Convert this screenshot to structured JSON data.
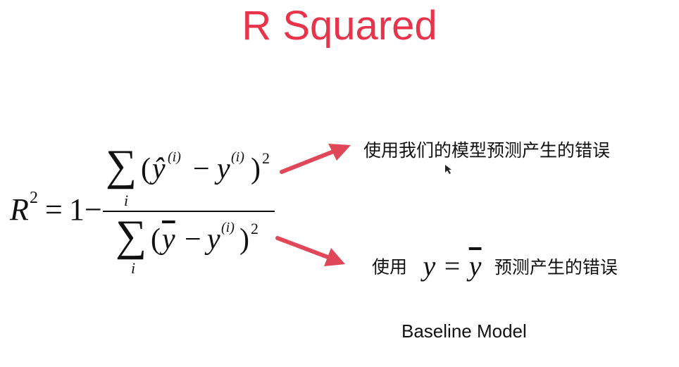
{
  "title": "R Squared",
  "formula": {
    "lhs": "R",
    "lhs_sup": "2",
    "equals": "=",
    "one_minus": "1−",
    "sum": "∑",
    "index": "i",
    "numerator": {
      "open": "(",
      "yhat": "ŷ",
      "sup_i": "(i)",
      "minus": "−",
      "y": "y",
      "close": ")",
      "power": "2"
    },
    "denominator": {
      "open": "(",
      "ybar": "y",
      "minus": "−",
      "y": "y",
      "sup_i": "(i)",
      "close": ")",
      "power": "2"
    }
  },
  "annotations": {
    "top_text": "使用我们的模型预测产生的错误",
    "bottom_prefix": "使用",
    "bottom_math_y": "y",
    "bottom_math_eq": "=",
    "bottom_math_ybar": "y",
    "bottom_suffix": "预测产生的错误",
    "baseline_label": "Baseline Model"
  },
  "colors": {
    "title": "#e8334a",
    "arrow": "#e0485a",
    "text": "#111111"
  }
}
